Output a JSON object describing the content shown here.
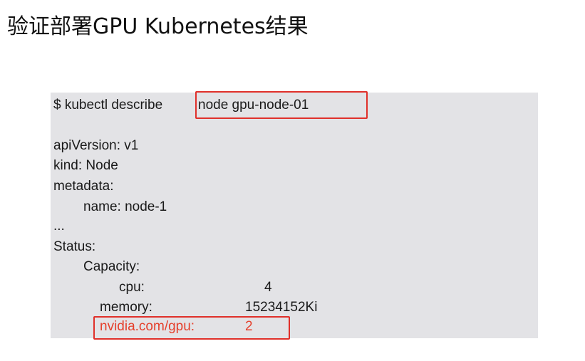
{
  "slide": {
    "title": "验证部署GPU Kubernetes结果"
  },
  "code": {
    "command_prefix": "$ kubectl describe",
    "command_target": "node gpu-node-01",
    "api_version": "apiVersion: v1",
    "kind": "kind: Node",
    "metadata": "metadata:",
    "name": "name: node-1",
    "ellipsis": "...",
    "status": "Status:",
    "capacity": "Capacity:",
    "cpu_key": "cpu:",
    "cpu_value": "4",
    "memory_key": "memory:",
    "memory_value": "15234152Ki",
    "gpu_key": "nvidia.com/gpu:",
    "gpu_value": "2"
  },
  "colors": {
    "highlight": "#e0302a",
    "highlight_text": "#e5402c",
    "panel_background": "#e3e3e6"
  }
}
